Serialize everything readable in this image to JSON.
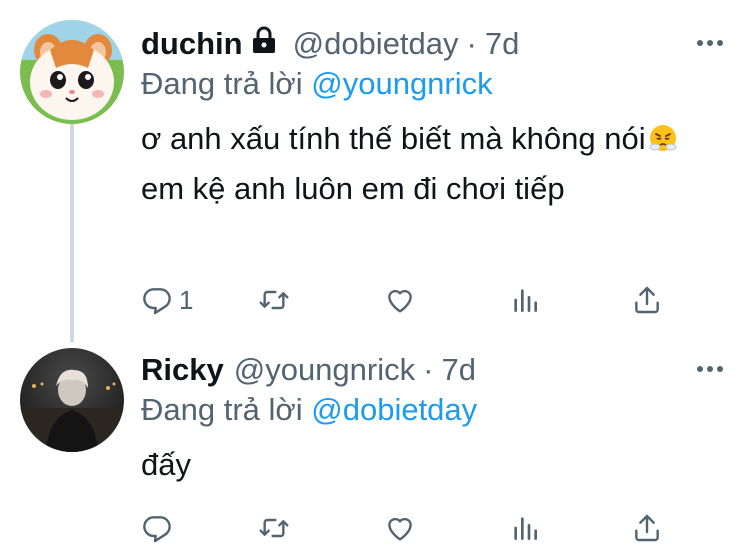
{
  "tweets": [
    {
      "display_name": "duchin",
      "handle": "@dobietday",
      "separator": "·",
      "time": "7d",
      "reply_prefix": "Đang trả lời",
      "reply_to": "@youngnrick",
      "text_part1": "ơ anh xấu tính thế biết mà không nói",
      "emoji": "face-with-steam-from-nose",
      "text_part2": " em kệ anh luôn em đi chơi tiếp",
      "reply_count": "1",
      "protected": true,
      "avatar": "cartoon-hamster"
    },
    {
      "display_name": "Ricky",
      "handle": "@youngnrick",
      "separator": "·",
      "time": "7d",
      "reply_prefix": "Đang trả lời",
      "reply_to": "@dobietday",
      "text": "đấy",
      "reply_count": "",
      "avatar": "person-photo"
    }
  ],
  "colors": {
    "link": "#1d9bf0",
    "secondary_text": "#536471",
    "primary_text": "#0f1419",
    "thread_line": "#cfd9de"
  },
  "icons": [
    "reply-icon",
    "retweet-icon",
    "like-icon",
    "views-icon",
    "share-icon",
    "more-icon",
    "lock-icon"
  ]
}
